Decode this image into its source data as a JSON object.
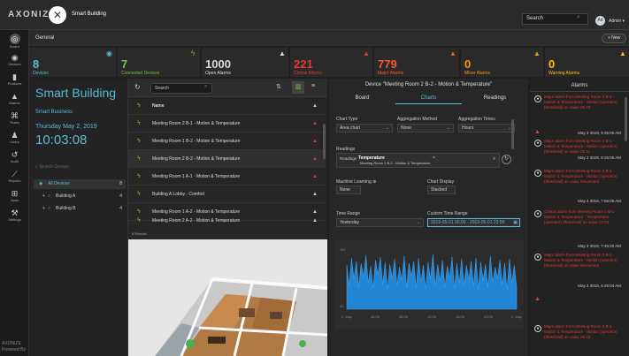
{
  "topbar": {
    "logo": "AXONIZE",
    "brand_name": "Smart Building",
    "search_placeholder": "Search",
    "avatar_initials": "Ad",
    "admin_label": "Admin ▾"
  },
  "nav": [
    "Board",
    "Devices",
    "Products",
    "Alarms",
    "Rules",
    "Users",
    "Audit",
    "Reports",
    "Apps",
    "Settings"
  ],
  "nav_footer": [
    "AXONIZE",
    "Powered By"
  ],
  "tabs": {
    "general": "General",
    "new": "+ New"
  },
  "stats": [
    {
      "value": "8",
      "label": "Devices",
      "color": "#5bbcd6"
    },
    {
      "value": "7",
      "label": "Connected Devices",
      "color": "#7cc242"
    },
    {
      "value": "1000",
      "label": "Open Alarms",
      "color": "#dddddd"
    },
    {
      "value": "221",
      "label": "Critical Alarms",
      "color": "#e53935"
    },
    {
      "value": "779",
      "label": "Major Alarms",
      "color": "#ff5722"
    },
    {
      "value": "0",
      "label": "Minor Alarms",
      "color": "#ff9800"
    },
    {
      "value": "0",
      "label": "Warning Alarms",
      "color": "#ffc107"
    }
  ],
  "sidebar": {
    "title": "Smart Building",
    "subtitle": "Smart Business",
    "date": "Thursday May 2, 2019",
    "time": "10:03:08",
    "search_placeholder": "Search Groups",
    "groups": [
      {
        "name": "All Devices",
        "count": "8"
      },
      {
        "name": "Building A",
        "count": "4"
      },
      {
        "name": "Building B",
        "count": "4"
      }
    ]
  },
  "list": {
    "search_placeholder": "Search",
    "header": "Name",
    "results": "8 Results",
    "rows": [
      "Meeting Room 2 B-1 - Motion & Temperature",
      "Meeting Room 1 B-2 - Motion & Temperature",
      "Meeting Room 2 B-2 - Motion & Temperature",
      "Meeting Room 1 A-1 - Motion & Temperature",
      "Building A Lobby - Comfort",
      "Meeting Room 1 A-2 - Motion & Temperature",
      "Meeting Room 2 A-2 - Motion & Temperature"
    ]
  },
  "device": {
    "title": "Device \"Meeting Room 2 B-2 - Motion & Temperature\"",
    "tabs": [
      "Board",
      "Charts",
      "Readings"
    ],
    "chart_type_label": "Chart Type",
    "chart_type": "Area chart",
    "agg_method_label": "Aggregation Method",
    "agg_method": "None",
    "agg_times_label": "Aggregation Times",
    "agg_times": "Hours",
    "readings_label": "Readings",
    "readings_prefix": "Readings",
    "reading_tag": "Temperature",
    "reading_tag_sub": "Meeting Room 2 B-2 - Motion & Temperature",
    "ml_label": "Machine Learning ⊕",
    "ml_value": "None",
    "display_label": "Chart Display",
    "display_value": "Stacked",
    "range_label": "Time Range",
    "range_value": "Yesterday",
    "custom_label": "Custom Time Range",
    "custom_value": "2019-05-01 00:00 - 2019-05-01 23:59",
    "y_top": "100",
    "y_bottom": "40",
    "x_ticks": [
      "2. May",
      "04:00",
      "08:00",
      "12:00",
      "16:00",
      "20:00",
      "2. May"
    ]
  },
  "chart_data": {
    "type": "area",
    "title": "",
    "xlabel": "",
    "ylabel": "",
    "ylim": [
      40,
      100
    ],
    "x": [
      "00:00",
      "04:00",
      "08:00",
      "12:00",
      "16:00",
      "20:00",
      "24:00"
    ],
    "series": [
      {
        "name": "Temperature",
        "values": [
          84,
          63,
          91,
          70,
          88,
          62,
          86,
          72,
          94,
          66,
          83,
          61,
          89,
          74,
          92,
          65,
          87,
          60,
          85,
          71,
          90,
          64,
          82,
          69,
          93,
          62,
          86,
          73,
          88,
          61,
          91,
          67,
          84,
          60,
          87,
          70,
          95,
          63,
          85,
          68,
          89,
          62,
          83,
          72,
          92,
          61,
          86,
          66,
          90,
          64,
          84,
          70,
          88,
          63,
          91,
          60,
          87,
          69,
          85,
          62,
          93,
          67,
          82,
          71,
          89,
          64,
          86,
          60,
          90,
          66,
          84,
          62
        ]
      }
    ]
  },
  "alarms": {
    "title": "Alarms",
    "items": [
      {
        "text": "Major alarm from Meeting Room 2 B-1 - Motion & Temperature - Motion (operator) (threshold) on value 25.72",
        "time": "May 2 2019, 9:35:05 AM",
        "color": "#e53935"
      },
      {
        "text": "Major alarm from Meeting Room 2 B-1 - Motion & Temperature - Motion (operator) (threshold) on value 26.11",
        "time": "May 2 2019, 8:25:05 AM",
        "color": "#e53935"
      },
      {
        "text": "Major alarm from Meeting Room 2 B-1 - Motion & Temperature - Motion (operator) (threshold) on value Movement",
        "time": "May 2 2019, 7:55:05 AM",
        "color": "#e53935"
      },
      {
        "text": "Critical alarm from Meeting Room 2 B-1 - Motion & Temperature - Temperature (operator) (threshold) on value 27.03",
        "time": "May 2 2019, 7:45:20 AM",
        "color": "#e53935"
      },
      {
        "text": "Major alarm from Meeting Room 2 B-2 - Motion & Temperature - Motion (operator) (threshold) on value Movement",
        "time": "May 2 2019, 6:25:04 AM",
        "color": "#e53935"
      },
      {
        "text": "Major alarm from Meeting Room 2 B-1 - Motion & Temperature - Motion (operator) (threshold) on value 26.23",
        "time": "",
        "color": "#e53935"
      }
    ]
  }
}
